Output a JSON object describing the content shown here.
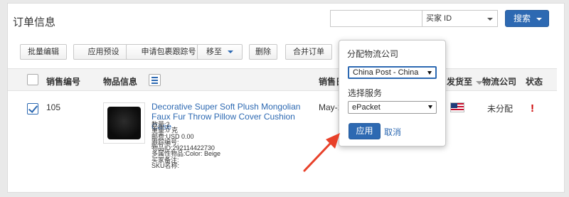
{
  "page_title": "订单信息",
  "search": {
    "input_value": "",
    "field_select": "买家 ID",
    "button_label": "搜索"
  },
  "toolbar": {
    "bulk_edit": "批量编辑",
    "apply_preset": "应用预设",
    "request_tracking": "申请包裹跟踪号",
    "move_to": "移至",
    "delete": "删除",
    "merge_orders": "合并订单"
  },
  "table": {
    "headers": {
      "sale_no": "销售编号",
      "item_info": "物品信息",
      "sale_date": "销售日",
      "ship_to": "发货至",
      "carrier": "物流公司",
      "status": "状态"
    },
    "row": {
      "sale_no": "105",
      "title": "Decorative Super Soft Plush Mongolian Faux Fur Throw Pillow Cover Cushion Case",
      "meta": [
        "数量:2",
        "重量:0 克",
        "邮费:USD 0.00",
        "跟踪编号:",
        "物品ID:292114422730",
        "多属性物品:Color: Beige",
        "买家备注:",
        "SKU名称:"
      ],
      "sale_date": "May-1",
      "carrier": "未分配",
      "status_mark": "!"
    }
  },
  "popover": {
    "title": "分配物流公司",
    "carrier_value": "China Post - China",
    "service_label": "选择服务",
    "service_value": "ePacket",
    "apply_label": "应用",
    "cancel_label": "取消"
  },
  "colors": {
    "accent": "#2d69b2",
    "alert": "#cc0000",
    "annotation_arrow": "#e8412a"
  },
  "icons": [
    "chevron-down-icon",
    "list-icon",
    "sort-icon",
    "us-flag-icon",
    "alert-icon",
    "checkbox-icon"
  ]
}
